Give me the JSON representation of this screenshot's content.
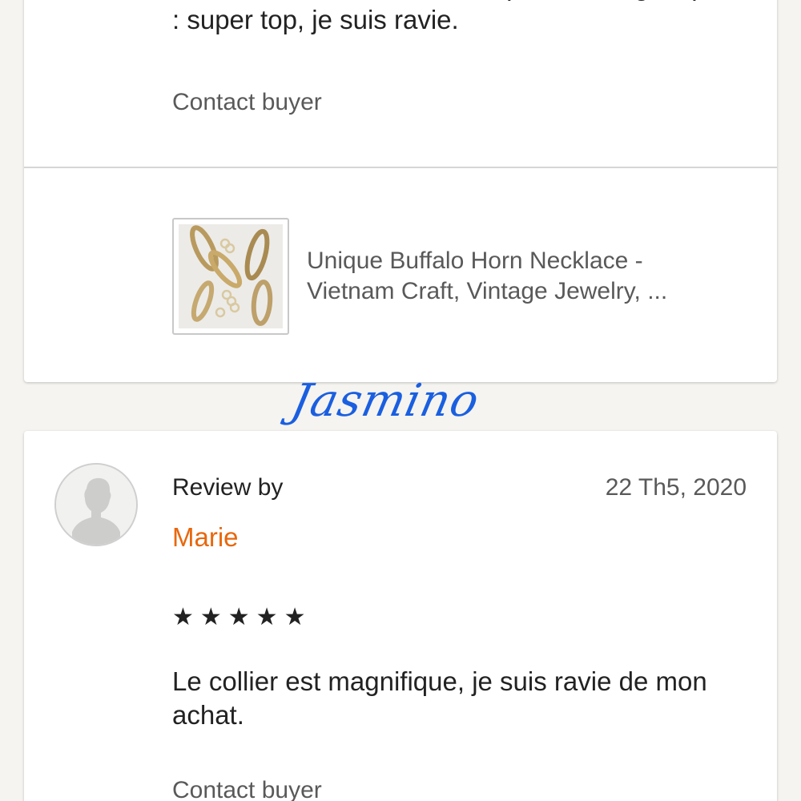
{
  "previous_review": {
    "text": "J'ai commandé deux collier qui sont magnifiques : super top, je suis ravie.",
    "contact_label": "Contact buyer",
    "listing": {
      "title_line1": "Unique Buffalo Horn Necklace -",
      "title_line2": "Vietnam Craft, Vintage Jewelry, ..."
    }
  },
  "watermark": "Jasmino",
  "review": {
    "by_label": "Review by",
    "reviewer_name": "Marie",
    "date": "22 Th5, 2020",
    "rating": 5,
    "stars": "★★★★★",
    "text": "Le collier est magnifique, je suis ravie de mon achat.",
    "contact_label": "Contact buyer"
  },
  "colors": {
    "background": "#f5f4f0",
    "card": "#ffffff",
    "reviewer_name": "#e8670c",
    "watermark": "#1a5fe0",
    "muted_text": "#595959"
  },
  "icons": {
    "avatar": "default-user-silhouette-icon",
    "rating": "star-icon"
  }
}
